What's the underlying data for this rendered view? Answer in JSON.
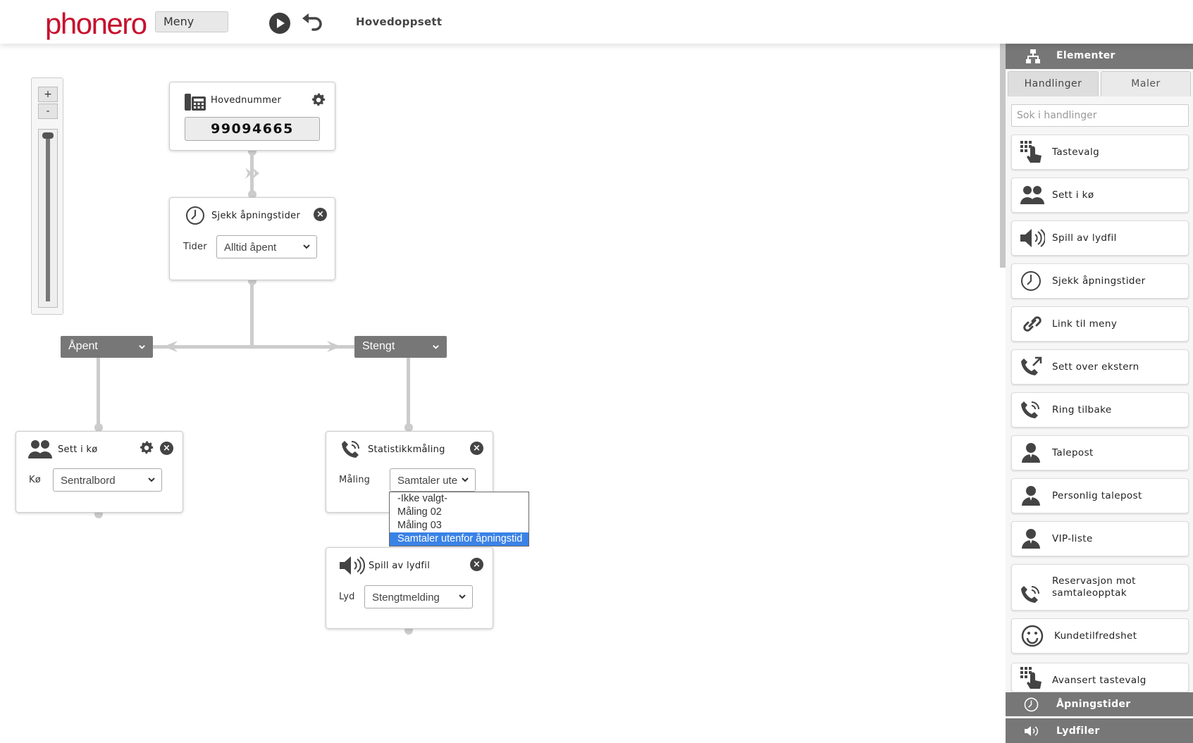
{
  "header": {
    "logo": "phonero",
    "menu_label": "Meny",
    "page_title": "Hovedoppsett"
  },
  "zoom": {
    "plus": "+",
    "minus": "-",
    "level": 1.0
  },
  "nodes": {
    "main_number": {
      "title": "Hovednummer",
      "number": "99094665",
      "icon": "phone-icon"
    },
    "hours": {
      "title": "Sjekk åpningstider",
      "field_label": "Tider",
      "value": "Alltid åpent",
      "icon": "clock-icon"
    },
    "queue": {
      "title": "Sett i kø",
      "field_label": "Kø",
      "value": "Sentralbord",
      "icon": "users-icon"
    },
    "stats": {
      "title": "Statistikkmåling",
      "field_label": "Måling",
      "value": "Samtaler ute",
      "icon": "phone-signal-icon"
    },
    "audio": {
      "title": "Spill av lydfil",
      "field_label": "Lyd",
      "value": "Stengtmelding",
      "icon": "speaker-icon"
    }
  },
  "branches": {
    "open": "Åpent",
    "closed": "Stengt"
  },
  "stats_dropdown": {
    "options": [
      "-Ikke valgt-",
      "Måling 02",
      "Måling 03",
      "Samtaler utenfor åpningstid"
    ],
    "selected_index": 3
  },
  "sidebar": {
    "header": "Elementer",
    "tabs": [
      "Handlinger",
      "Maler"
    ],
    "active_tab": "Handlinger",
    "search_placeholder": "Sok i handlinger",
    "actions": [
      {
        "label": "Tastevalg",
        "icon": "keypad-icon"
      },
      {
        "label": "Sett i kø",
        "icon": "users-icon"
      },
      {
        "label": "Spill av lydfil",
        "icon": "speaker-icon"
      },
      {
        "label": "Sjekk åpningstider",
        "icon": "clock-icon"
      },
      {
        "label": "Link til meny",
        "icon": "link-icon"
      },
      {
        "label": "Sett over ekstern",
        "icon": "phone-forward-icon"
      },
      {
        "label": "Ring tilbake",
        "icon": "phone-signal-icon"
      },
      {
        "label": "Talepost",
        "icon": "user-icon"
      },
      {
        "label": "Personlig talepost",
        "icon": "user-icon"
      },
      {
        "label": "VIP-liste",
        "icon": "user-icon"
      },
      {
        "label": "Reservasjon mot samtaleopptak",
        "icon": "phone-signal-icon"
      },
      {
        "label": "Kundetilfredshet",
        "icon": "smiley-icon"
      },
      {
        "label": "Avansert tastevalg",
        "icon": "keypad-icon"
      }
    ],
    "footer_sections": [
      {
        "label": "Åpningstider",
        "icon": "clock-icon"
      },
      {
        "label": "Lydfiler",
        "icon": "speaker-icon"
      }
    ]
  }
}
